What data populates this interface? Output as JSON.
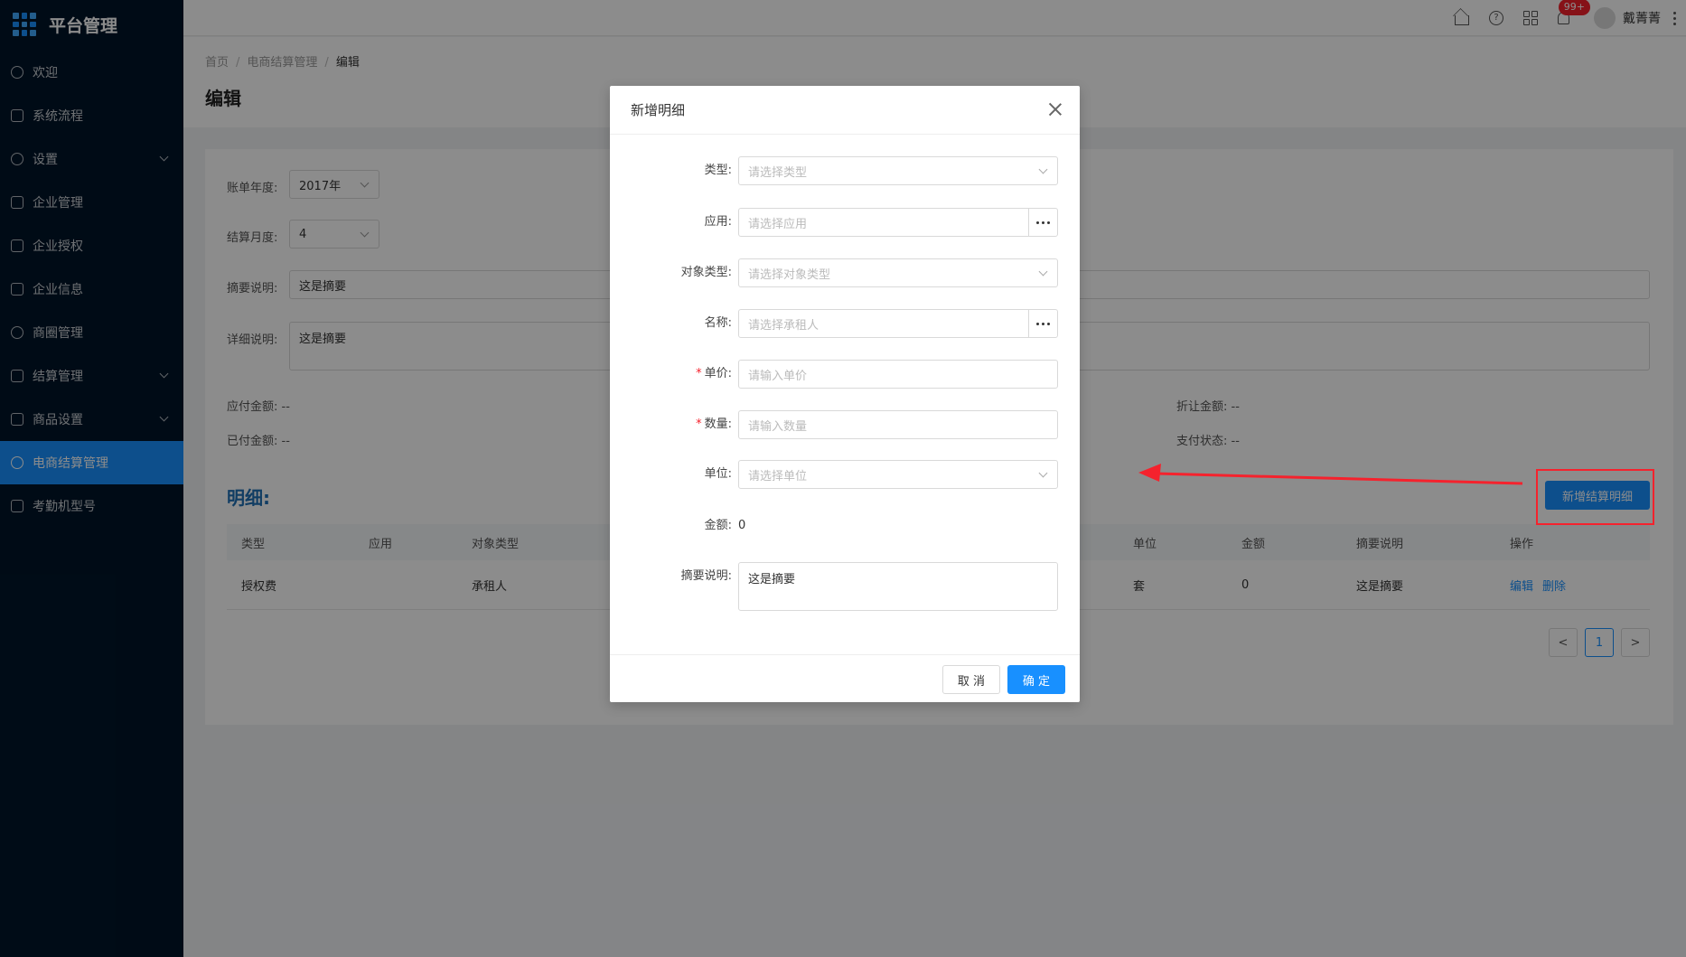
{
  "app": {
    "title": "平台管理"
  },
  "sidebar": {
    "items": [
      {
        "label": "欢迎",
        "icon": "smile-icon"
      },
      {
        "label": "系统流程",
        "icon": "mail-icon"
      },
      {
        "label": "设置",
        "icon": "gear-icon",
        "expandable": true
      },
      {
        "label": "企业管理",
        "icon": "mail-icon"
      },
      {
        "label": "企业授权",
        "icon": "mail-icon"
      },
      {
        "label": "企业信息",
        "icon": "mail-icon"
      },
      {
        "label": "商圈管理",
        "icon": "compass-icon"
      },
      {
        "label": "结算管理",
        "icon": "calculator-icon",
        "expandable": true
      },
      {
        "label": "商品设置",
        "icon": "appstore-icon",
        "expandable": true
      },
      {
        "label": "电商结算管理",
        "icon": "dashboard-icon",
        "active": true
      },
      {
        "label": "考勤机型号",
        "icon": "appstore-icon"
      }
    ]
  },
  "header": {
    "badge": "99+",
    "username": "戴菁菁"
  },
  "breadcrumb": [
    "首页",
    "电商结算管理",
    "编辑"
  ],
  "page": {
    "title": "编辑"
  },
  "form": {
    "year_label": "账单年度:",
    "year_value": "2017年",
    "month_label": "结算月度:",
    "month_value": "4",
    "summary_label": "摘要说明:",
    "summary_value": "这是摘要",
    "detail_label": "详细说明:",
    "detail_value": "这是摘要",
    "payable_label": "应付金额:",
    "payable_value": "--",
    "paid_label": "已付金额:",
    "paid_value": "--",
    "discount_label": "折让金额:",
    "discount_value": "--",
    "paystatus_label": "支付状态:",
    "paystatus_value": "--"
  },
  "detail": {
    "title": "明细:",
    "add_button": "新增结算明细",
    "columns": [
      "类型",
      "应用",
      "对象类型",
      "单位",
      "金额",
      "摘要说明",
      "操作"
    ],
    "rows": [
      {
        "type": "授权费",
        "app": "",
        "object_type": "承租人",
        "unit": "套",
        "amount": "0",
        "summary": "这是摘要",
        "edit": "编辑",
        "delete": "删除"
      }
    ],
    "pager": {
      "prev": "<",
      "page": "1",
      "next": ">"
    }
  },
  "modal": {
    "title": "新增明细",
    "fields": {
      "type_label": "类型:",
      "type_placeholder": "请选择类型",
      "app_label": "应用:",
      "app_placeholder": "请选择应用",
      "objtype_label": "对象类型:",
      "objtype_placeholder": "请选择对象类型",
      "name_label": "名称:",
      "name_placeholder": "请选择承租人",
      "price_label": "单价:",
      "price_placeholder": "请输入单价",
      "qty_label": "数量:",
      "qty_placeholder": "请输入数量",
      "unit_label": "单位:",
      "unit_placeholder": "请选择单位",
      "amount_label": "金额:",
      "amount_value": "0",
      "summary_label": "摘要说明:",
      "summary_value": "这是摘要",
      "required_mark": "*"
    },
    "cancel": "取 消",
    "ok": "确 定"
  },
  "colors": {
    "primary": "#1890ff",
    "sidebar": "#001529",
    "annotation": "#f5222d"
  }
}
